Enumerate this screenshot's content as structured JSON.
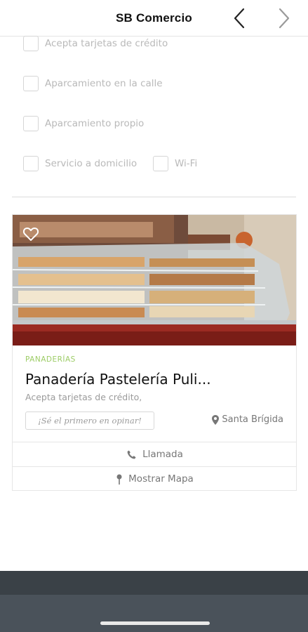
{
  "header": {
    "title": "SB Comercio",
    "back_icon": "chevron-left-icon",
    "forward_icon": "chevron-right-icon"
  },
  "filters": [
    {
      "label": "Acepta tarjetas de crédito",
      "checked": false
    },
    {
      "label": "Aparcamiento en la calle",
      "checked": false
    },
    {
      "label": "Aparcamiento propio",
      "checked": false
    },
    {
      "label": "Servicio a domicilio",
      "checked": false
    },
    {
      "label": "Wi-Fi",
      "checked": false
    }
  ],
  "card": {
    "category": "PANADERÍAS",
    "name": "Panadería Pastelería Puli...",
    "features": "Acepta tarjetas de crédito,",
    "review_cta": "¡Sé el primero en opinar!",
    "location": "Santa Brígida",
    "call_label": "Llamada",
    "map_label": "Mostrar Mapa",
    "favorite_icon": "heart-outline-icon"
  },
  "colors": {
    "accent_category": "#9ccc65",
    "bottom_bar": "#3a4147",
    "system_nav": "#4a525a"
  }
}
